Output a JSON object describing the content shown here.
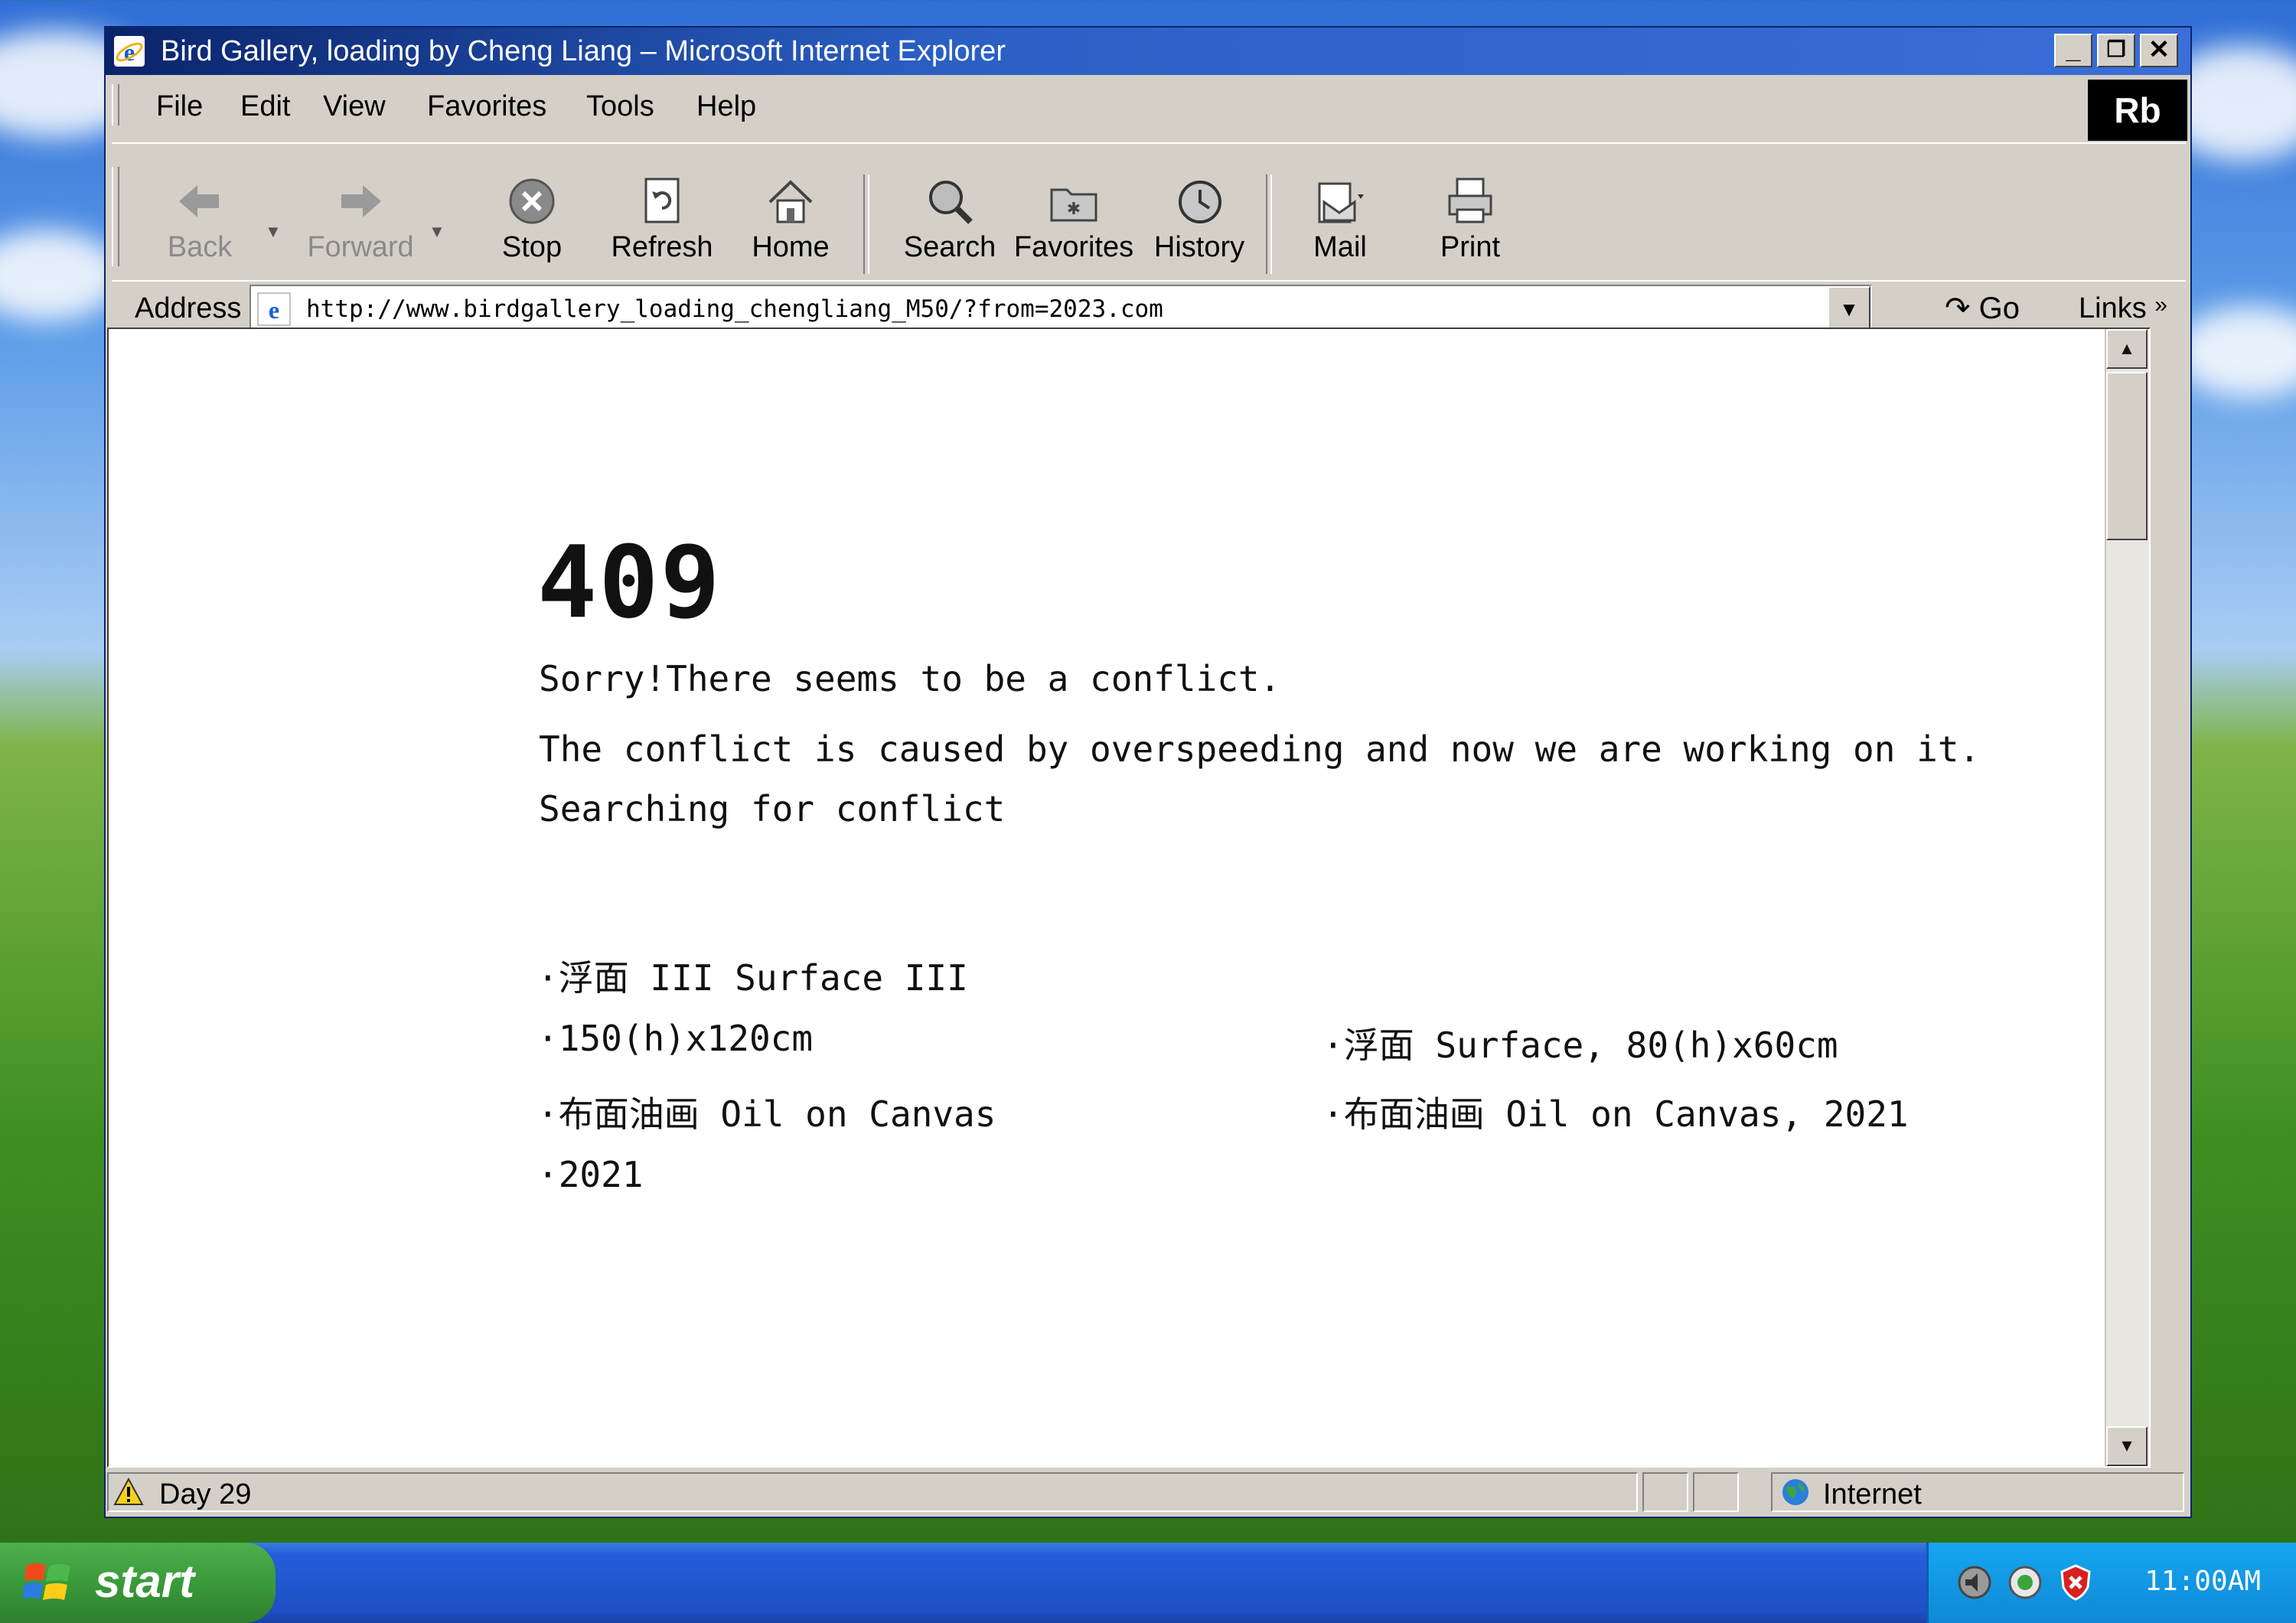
{
  "window": {
    "title": "Bird Gallery, loading by Cheng Liang – Microsoft Internet Explorer",
    "controls": {
      "minimize": "_",
      "restore": "❐",
      "close": "✕"
    }
  },
  "menu": {
    "items": [
      "File",
      "Edit",
      "View",
      "Favorites",
      "Tools",
      "Help"
    ],
    "brand": "Rb"
  },
  "toolbar": {
    "back": "Back",
    "forward": "Forward",
    "stop": "Stop",
    "refresh": "Refresh",
    "home": "Home",
    "search": "Search",
    "favorites": "Favorites",
    "history": "History",
    "mail": "Mail",
    "print": "Print"
  },
  "address": {
    "label": "Address",
    "url": "http://www.birdgallery_loading_chengliang_M50/?from=2023.com",
    "go": "Go",
    "links": "Links"
  },
  "page": {
    "code": "409",
    "line1": "Sorry!There seems to be a conflict.",
    "line2": "The conflict is caused by overspeeding and now we are working on it.",
    "line3": "Searching for conflict",
    "left": [
      "·浮面 III Surface III",
      "·150(h)x120cm",
      "·布面油画 Oil on Canvas",
      "·2021"
    ],
    "right": [
      "·浮面 Surface, 80(h)x60cm",
      "·布面油画 Oil on Canvas, 2021"
    ]
  },
  "status": {
    "text": "Day 29",
    "zone": "Internet"
  },
  "taskbar": {
    "start": "start",
    "clock": "11:00AM"
  }
}
